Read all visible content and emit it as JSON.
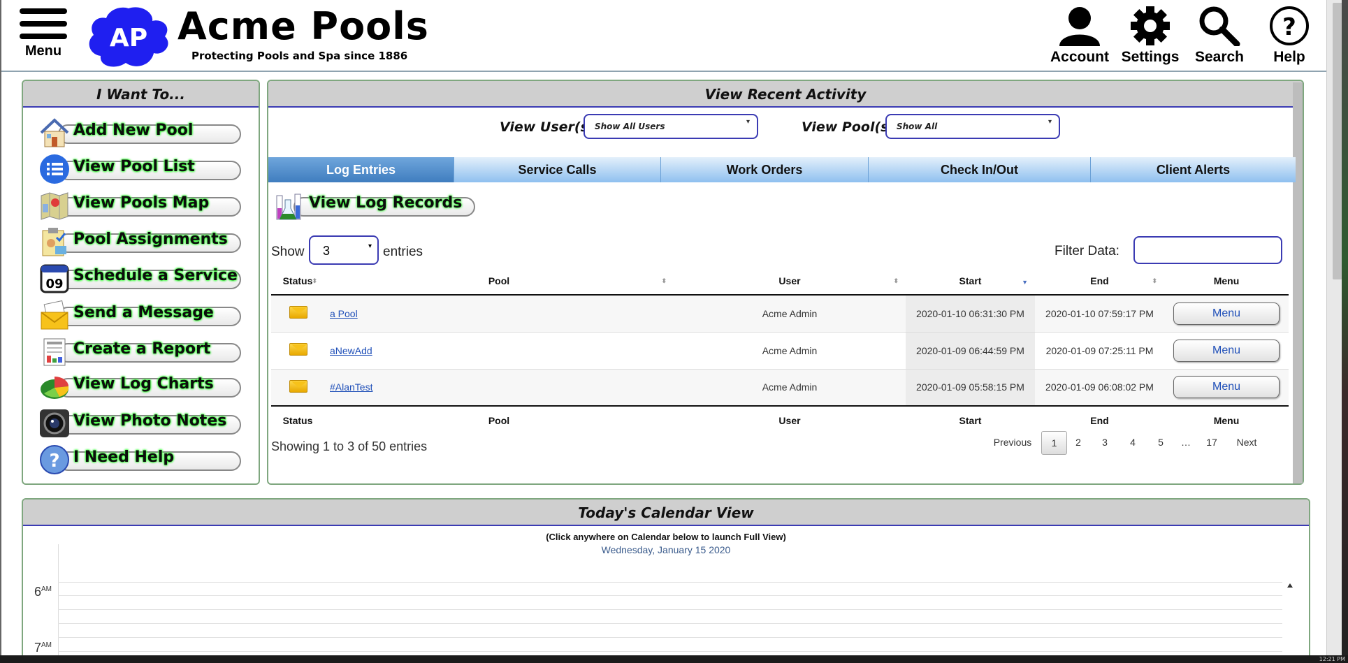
{
  "header": {
    "menu_label": "Menu",
    "logo_text": "AP",
    "brand": "Acme Pools",
    "tagline": "Protecting Pools and Spa since 1886",
    "account_label": "Account",
    "settings_label": "Settings",
    "search_label": "Search",
    "help_label": "Help"
  },
  "i_want_to": {
    "title": "I Want To...",
    "actions": [
      {
        "label": "Add New Pool",
        "icon": "house-icon"
      },
      {
        "label": "View Pool List",
        "icon": "list-icon"
      },
      {
        "label": "View Pools Map",
        "icon": "map-icon"
      },
      {
        "label": "Pool Assignments",
        "icon": "clipboard-icon"
      },
      {
        "label": "Schedule a Service",
        "icon": "calendar-icon"
      },
      {
        "label": "Send a Message",
        "icon": "envelope-icon"
      },
      {
        "label": "Create a Report",
        "icon": "report-icon"
      },
      {
        "label": "View Log Charts",
        "icon": "pie-chart-icon"
      },
      {
        "label": "View Photo Notes",
        "icon": "camera-icon"
      },
      {
        "label": "I Need Help",
        "icon": "question-icon"
      }
    ]
  },
  "recent": {
    "title": "View Recent Activity",
    "user_filter_label": "View User(s):",
    "user_filter_value": "Show All Users",
    "pool_filter_label": "View Pool(s):",
    "pool_filter_value": "Show All",
    "tabs": [
      "Log Entries",
      "Service Calls",
      "Work Orders",
      "Check In/Out",
      "Client Alerts"
    ],
    "active_tab": "Log Entries",
    "view_button": "View Log Records",
    "show_label": "Show",
    "entries_value": "3",
    "entries_label": "entries",
    "filter_label": "Filter Data:",
    "filter_value": "",
    "columns": [
      "Status",
      "Pool",
      "User",
      "Start",
      "End",
      "Menu"
    ],
    "rows": [
      {
        "pool": "a Pool",
        "user": "Acme Admin",
        "start": "2020-01-10 06:31:30 PM",
        "end": "2020-01-10 07:59:17 PM",
        "menu": "Menu"
      },
      {
        "pool": "aNewAdd",
        "user": "Acme Admin",
        "start": "2020-01-09 06:44:59 PM",
        "end": "2020-01-09 07:25:11 PM",
        "menu": "Menu"
      },
      {
        "pool": "#AlanTest",
        "user": "Acme Admin",
        "start": "2020-01-09 05:58:15 PM",
        "end": "2020-01-09 06:08:02 PM",
        "menu": "Menu"
      }
    ],
    "showing": "Showing 1 to 3 of 50 entries",
    "pager": [
      "Previous",
      "1",
      "2",
      "3",
      "4",
      "5",
      "…",
      "17",
      "Next"
    ],
    "current_page": "1"
  },
  "calendar": {
    "title": "Today's Calendar View",
    "hint": "(Click anywhere on Calendar below to launch Full View)",
    "date": "Wednesday, January 15 2020",
    "hours": [
      {
        "h": "6",
        "ampm": "AM"
      },
      {
        "h": "7",
        "ampm": "AM"
      }
    ]
  },
  "taskbar": {
    "clock": "12:21 PM"
  },
  "colors": {
    "accent_blue": "#3b3bb3",
    "panel_border": "#7fa77f",
    "tab_active": "#3f7dbf",
    "glow": "#3cff3c"
  }
}
